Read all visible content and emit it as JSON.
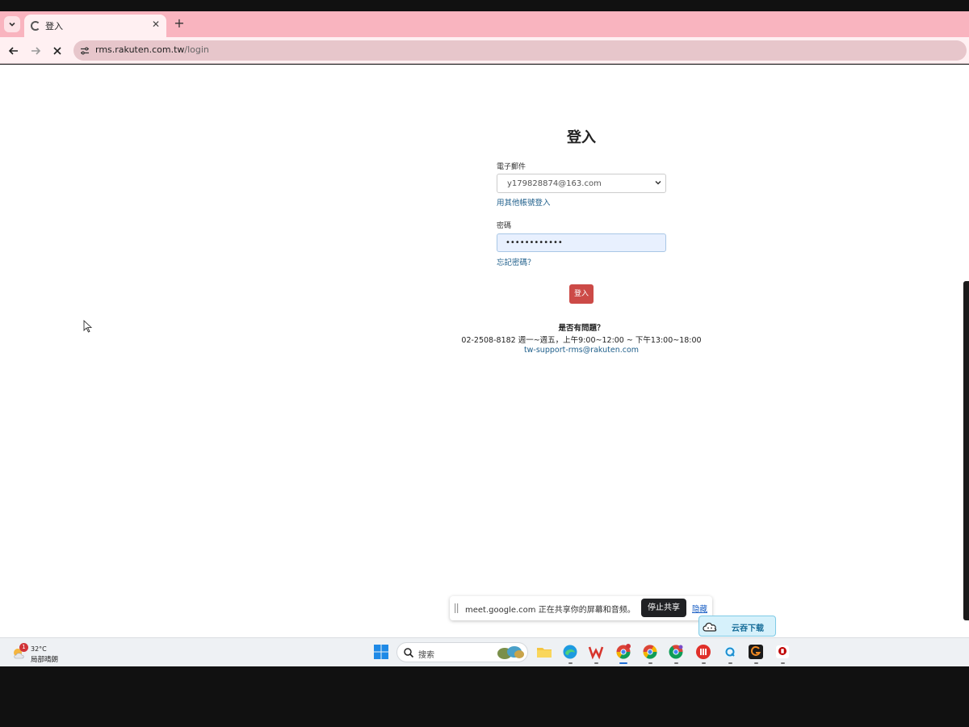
{
  "browser": {
    "tab_title": "登入",
    "url_domain": "rms.rakuten.com.tw",
    "url_path": "/login"
  },
  "login": {
    "title": "登入",
    "email_label": "電子郵件",
    "email_value": "y179828874@163.com",
    "other_account_link": "用其他帳號登入",
    "password_label": "密碼",
    "password_value": "••••••••••••",
    "forgot_link": "忘記密碼？",
    "submit_label": "登入"
  },
  "help": {
    "question": "是否有問題？",
    "phone": "02-2508-8182 週一~週五，上午9:00~12:00 ~ 下午13:00~18:00",
    "email": "tw-support-rms@rakuten.com"
  },
  "sharebar": {
    "message": "meet.google.com 正在共享你的屏幕和音频。",
    "stop_label": "停止共享",
    "hide_label": "隐藏"
  },
  "cloud_download": {
    "label": "云吞下载"
  },
  "taskbar": {
    "weather_badge": "1",
    "temperature": "32°C",
    "weather_desc": "局部晴朗",
    "search_label": "搜索"
  },
  "colors": {
    "tabstrip": "#f9b4bf",
    "login_button": "#cc4a47",
    "link": "#1f5f8b"
  }
}
